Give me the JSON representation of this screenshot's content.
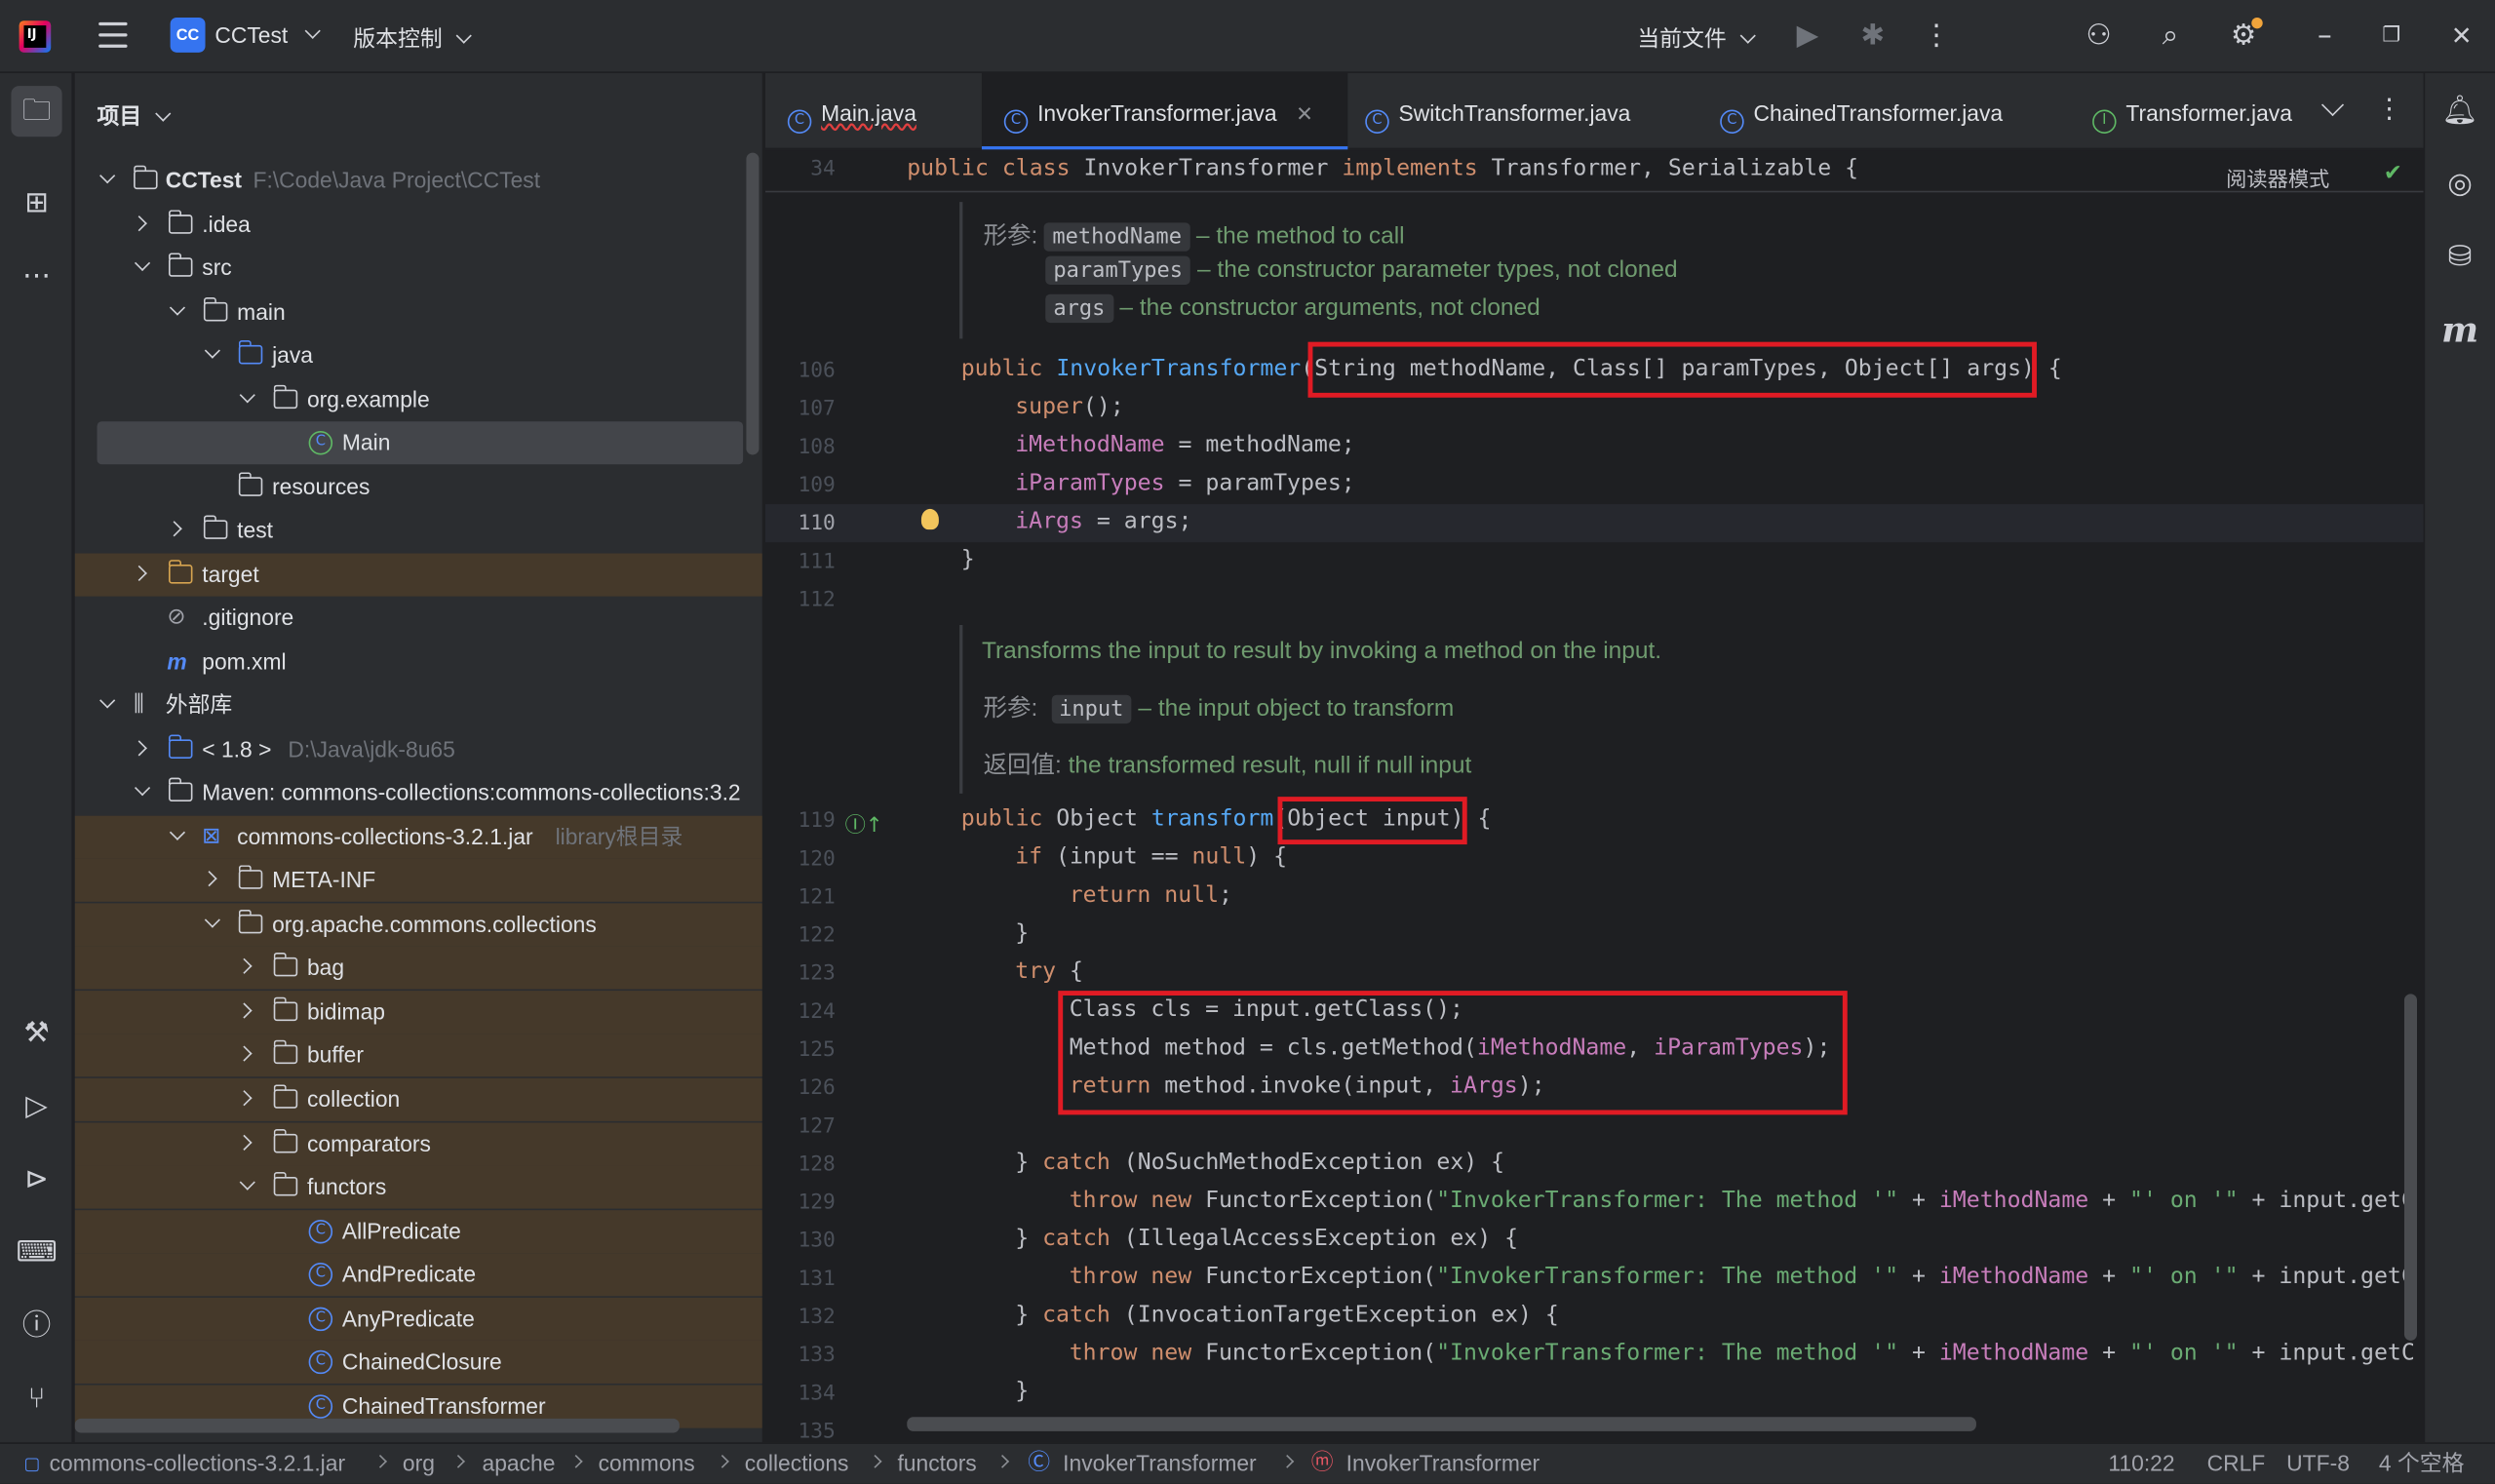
{
  "titlebar": {
    "app_logo": "intellij-logo",
    "project_badge": "CC",
    "project_name": "CCTest",
    "vcs_label": "版本控制",
    "current_file_label": "当前文件"
  },
  "project_panel": {
    "title": "项目",
    "tree": [
      {
        "label": "CCTest",
        "path": "F:\\Code\\Java Project\\CCTest"
      },
      {
        "label": ".idea"
      },
      {
        "label": "src"
      },
      {
        "label": "main"
      },
      {
        "label": "java"
      },
      {
        "label": "org.example"
      },
      {
        "label": "Main"
      },
      {
        "label": "resources"
      },
      {
        "label": "test"
      },
      {
        "label": "target"
      },
      {
        "label": ".gitignore"
      },
      {
        "label": "pom.xml"
      },
      {
        "label": "外部库"
      },
      {
        "label": "< 1.8 >",
        "path": "D:\\Java\\jdk-8u65"
      },
      {
        "label": "Maven: commons-collections:commons-collections:3.2"
      },
      {
        "label": "commons-collections-3.2.1.jar",
        "path": "library根目录"
      },
      {
        "label": "META-INF"
      },
      {
        "label": "org.apache.commons.collections"
      },
      {
        "label": "bag"
      },
      {
        "label": "bidimap"
      },
      {
        "label": "buffer"
      },
      {
        "label": "collection"
      },
      {
        "label": "comparators"
      },
      {
        "label": "functors"
      },
      {
        "label": "AllPredicate"
      },
      {
        "label": "AndPredicate"
      },
      {
        "label": "AnyPredicate"
      },
      {
        "label": "ChainedClosure"
      },
      {
        "label": "ChainedTransformer"
      }
    ]
  },
  "tabs": [
    {
      "label": "Main.java"
    },
    {
      "label": "InvokerTransformer.java"
    },
    {
      "label": "SwitchTransformer.java"
    },
    {
      "label": "ChainedTransformer.java"
    },
    {
      "label": "Transformer.java"
    }
  ],
  "editor": {
    "reader_mode": "阅读器模式",
    "sticky_line_no": "34",
    "sticky_line": "public class InvokerTransformer implements Transformer, Serializable {",
    "doc1": {
      "label": "形参:",
      "p1": "methodName",
      "d1": " – the method to call",
      "p2": "paramTypes",
      "d2": " – the constructor parameter types, not cloned",
      "p3": "args",
      "d3": " – the constructor arguments, not cloned"
    },
    "doc2": {
      "summary": "Transforms the input to result by invoking a method on the input.",
      "label": "形参:",
      "p1": "input",
      "d1": " – the input object to transform",
      "return_label": "返回值:",
      "return_text": " the transformed result, null if null input"
    },
    "line_numbers": [
      "106",
      "107",
      "108",
      "109",
      "110",
      "111",
      "112",
      "119",
      "120",
      "121",
      "122",
      "123",
      "124",
      "125",
      "126",
      "127",
      "128",
      "129",
      "130",
      "131",
      "132",
      "133",
      "134",
      "135"
    ],
    "current_line": "110"
  },
  "statusbar": {
    "crumbs": [
      "commons-collections-3.2.1.jar",
      "org",
      "apache",
      "commons",
      "collections",
      "functors",
      "InvokerTransformer",
      "InvokerTransformer"
    ],
    "position": "110:22",
    "line_ending": "CRLF",
    "encoding": "UTF-8",
    "indent": "4 个空格"
  },
  "colors": {
    "accent": "#3574f0",
    "highlight_box": "#e01b24",
    "library_row": "#45392a"
  }
}
